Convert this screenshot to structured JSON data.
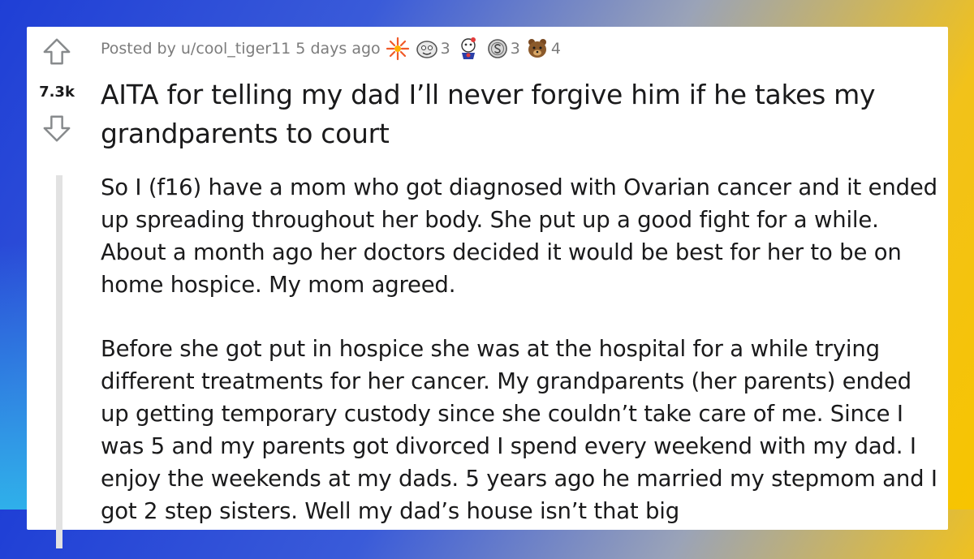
{
  "post": {
    "score": "7.3k",
    "posted_by": "Posted by u/cool_tiger11 5 days ago",
    "awards": [
      {
        "icon": "starburst-award-icon",
        "count": ""
      },
      {
        "icon": "face-award-icon",
        "count": "3"
      },
      {
        "icon": "wholesome-award-icon",
        "count": ""
      },
      {
        "icon": "silver-coin-award-icon",
        "count": "3"
      },
      {
        "icon": "bear-award-icon",
        "count": "4"
      }
    ],
    "title": "AITA for telling my dad I’ll never forgive him if he takes my grandparents to court",
    "paragraphs": [
      "So I (f16) have a mom who got diagnosed with Ovarian cancer and it ended up spreading throughout her body. She put up a good fight for a while. About a month ago her doctors decided it would be best for her to be on home hospice. My mom agreed.",
      "Before she got put in hospice she was at the hospital for a while trying different treatments for her cancer. My grandparents (her parents) ended up getting temporary custody since she couldn’t take care of me. Since I was 5 and my parents got divorced I spend every weekend with my dad. I enjoy the weekends at my dads. 5 years ago he married my stepmom and I got 2 step sisters. Well my dad’s house isn’t that big"
    ]
  },
  "colors": {
    "text": "#1a1a1b",
    "meta": "#7c7c7c",
    "arrow": "#878a8c"
  }
}
